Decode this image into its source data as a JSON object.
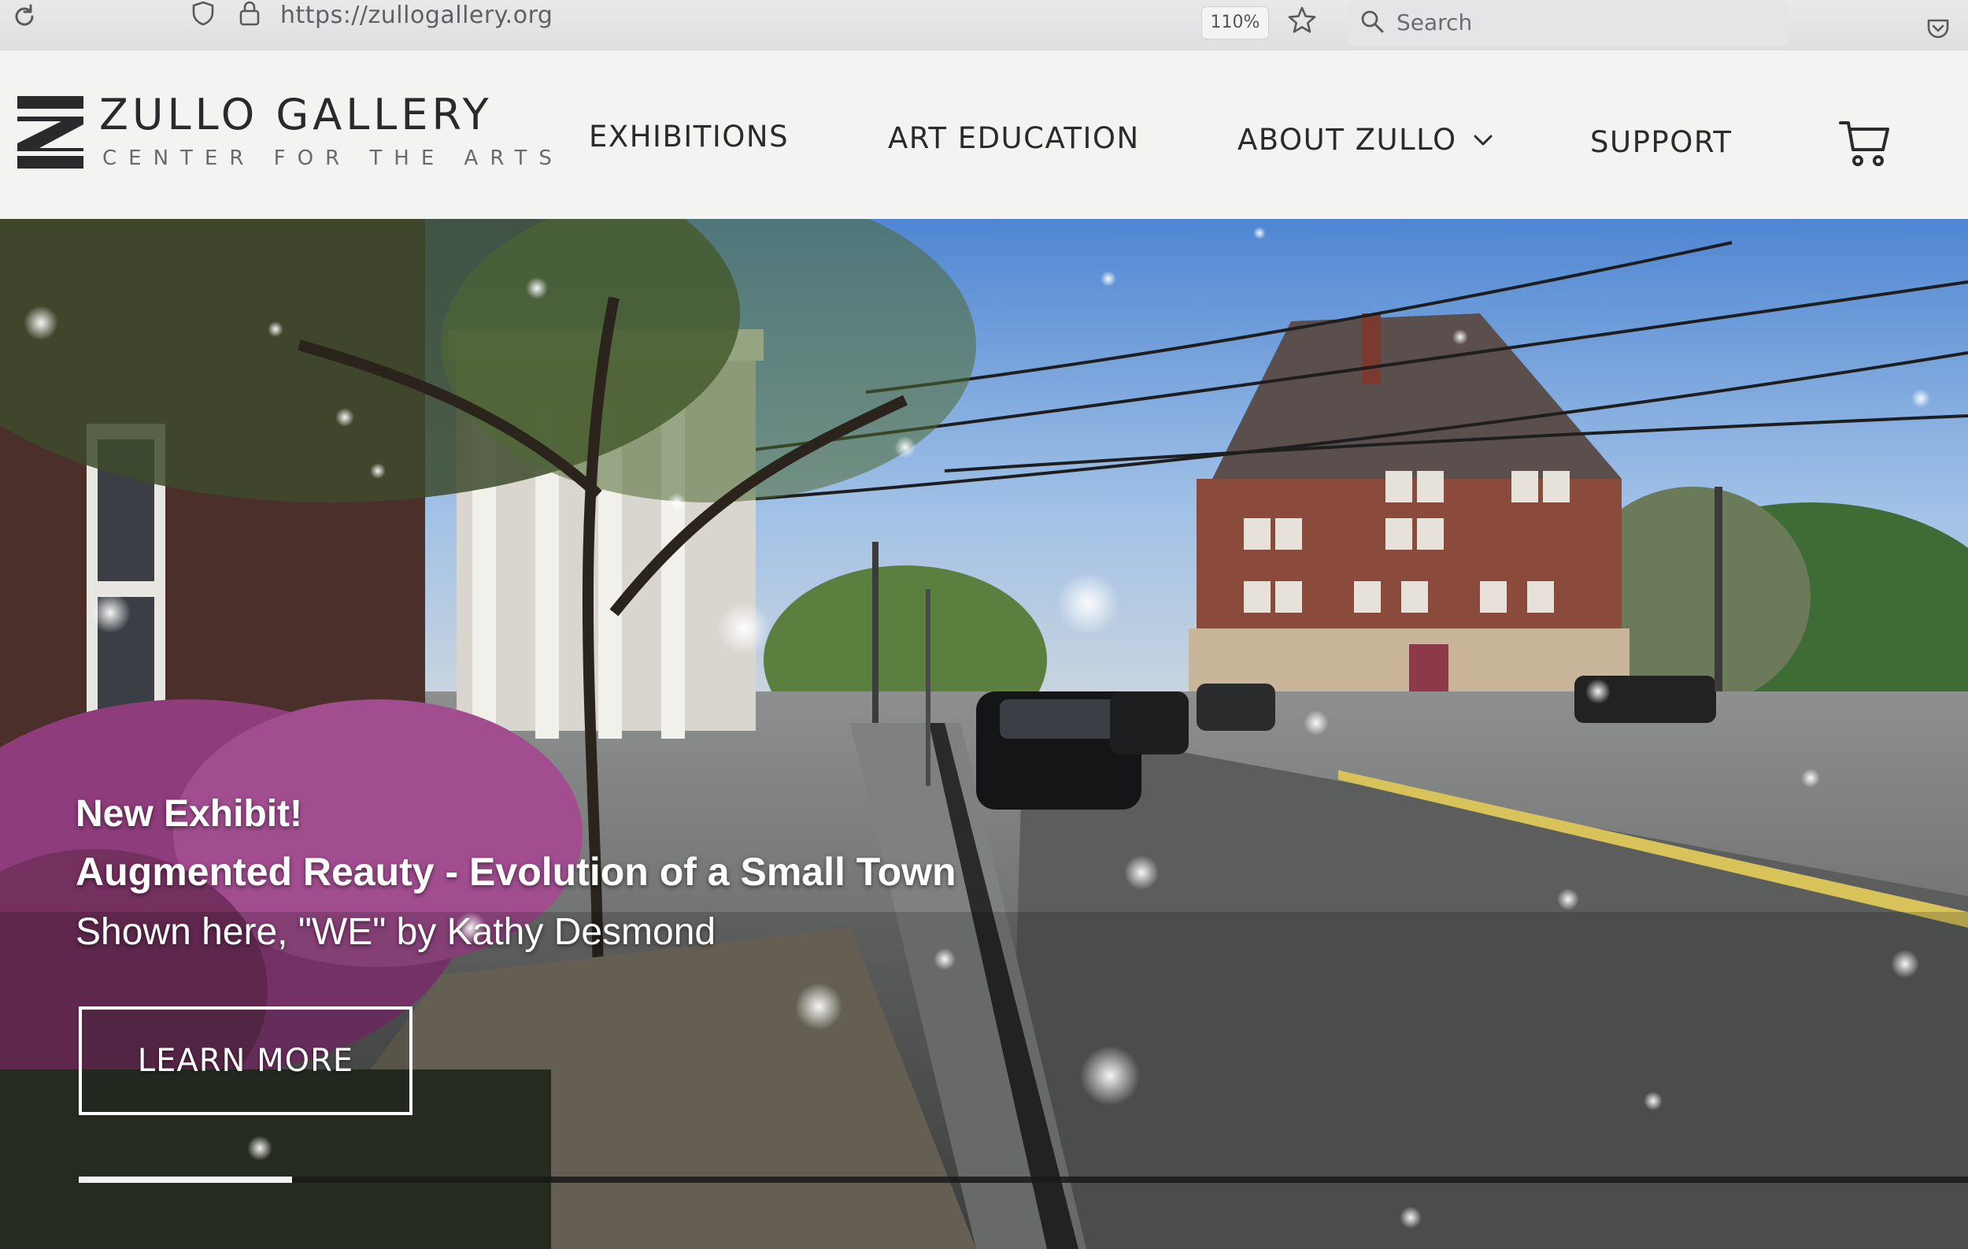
{
  "browser": {
    "url": "https://zullogallery.org",
    "zoom": "110%",
    "search_placeholder": "Search"
  },
  "site": {
    "brand": {
      "name": "ZULLO GALLERY",
      "tagline": "CENTER FOR THE ARTS"
    },
    "nav": {
      "exhibitions": "EXHIBITIONS",
      "art_education": "ART EDUCATION",
      "about": "ABOUT ZULLO",
      "support": "SUPPORT"
    }
  },
  "hero": {
    "eyebrow": "New Exhibit!",
    "title": "Augmented Reauty - Evolution of a Small Town",
    "subtitle": "Shown here, \"WE\" by Kathy Desmond",
    "cta_label": "LEARN MORE",
    "slider_progress": 0.113
  },
  "icons": {
    "reload": "reload-icon",
    "shield": "shield-icon",
    "lock": "lock-icon",
    "star": "star-icon",
    "search": "search-icon",
    "pocket": "pocket-icon",
    "chevron": "chevron-down-icon",
    "cart": "cart-icon"
  },
  "colors": {
    "header_bg": "#f3f3f1",
    "nav_text": "#2b2b2d",
    "hero_text": "#ffffff"
  }
}
